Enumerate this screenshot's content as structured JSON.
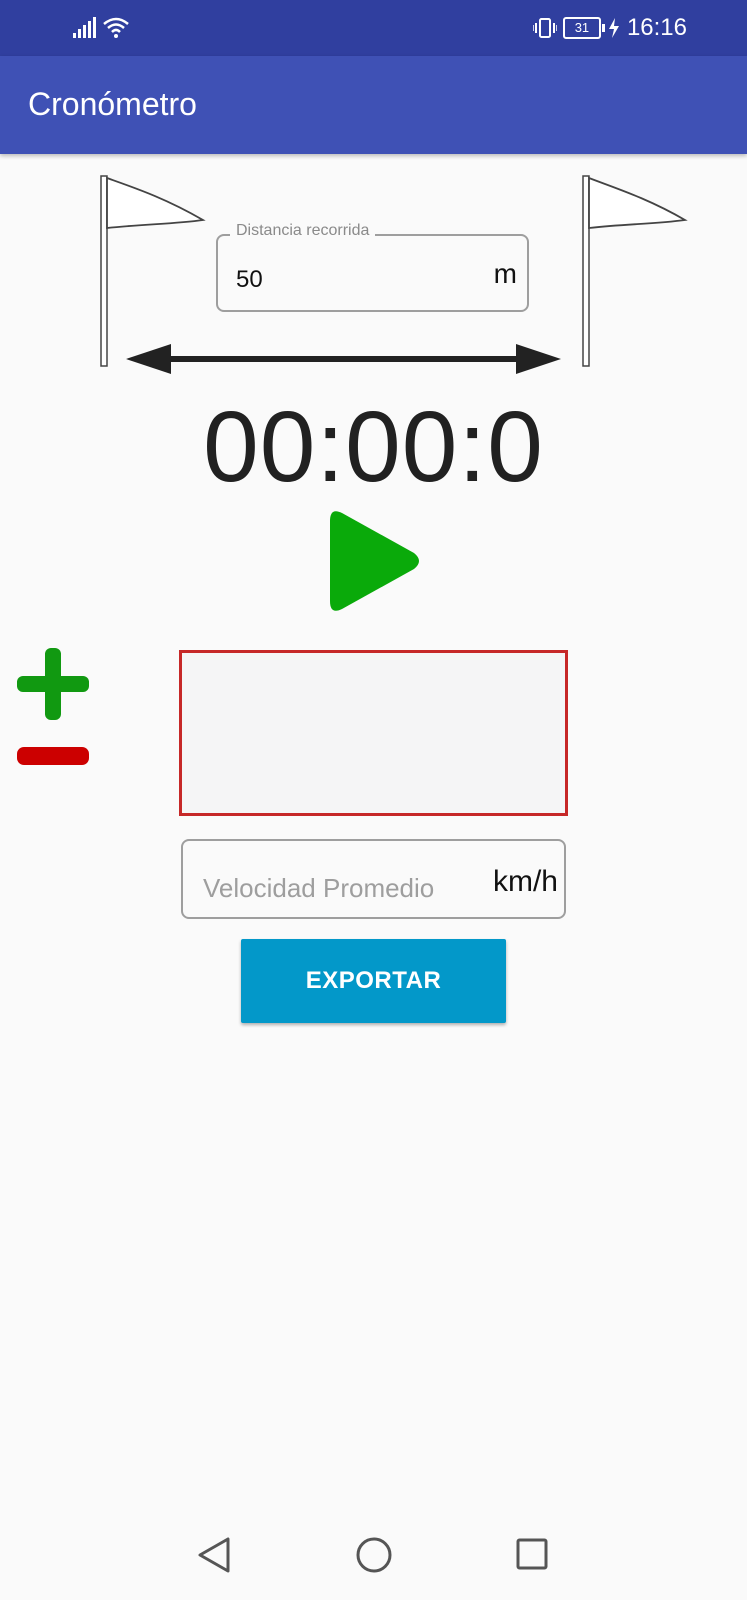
{
  "status_bar": {
    "time": "16:16",
    "battery_level": "31",
    "icons": [
      "signal-icon",
      "wifi-icon",
      "vibrate-icon",
      "battery-icon",
      "charging-icon"
    ]
  },
  "app_bar": {
    "title": "Cronómetro",
    "color": "#3f51b5"
  },
  "distance": {
    "label": "Distancia recorrida",
    "value": "50",
    "unit": "m"
  },
  "timer": {
    "display": "00:00:0"
  },
  "controls": {
    "play_icon": "play-icon",
    "play_color": "#0aaa0a",
    "plus_icon": "plus-icon",
    "plus_color": "#119911",
    "minus_icon": "minus-icon",
    "minus_color": "#cc0000"
  },
  "laps": {
    "border_color": "#c62828"
  },
  "speed": {
    "placeholder": "Velocidad Promedio",
    "unit": "km/h"
  },
  "export": {
    "label": "EXPORTAR",
    "color": "#0398c9"
  },
  "nav": {
    "icons": [
      "back-icon",
      "home-icon",
      "recents-icon"
    ]
  }
}
